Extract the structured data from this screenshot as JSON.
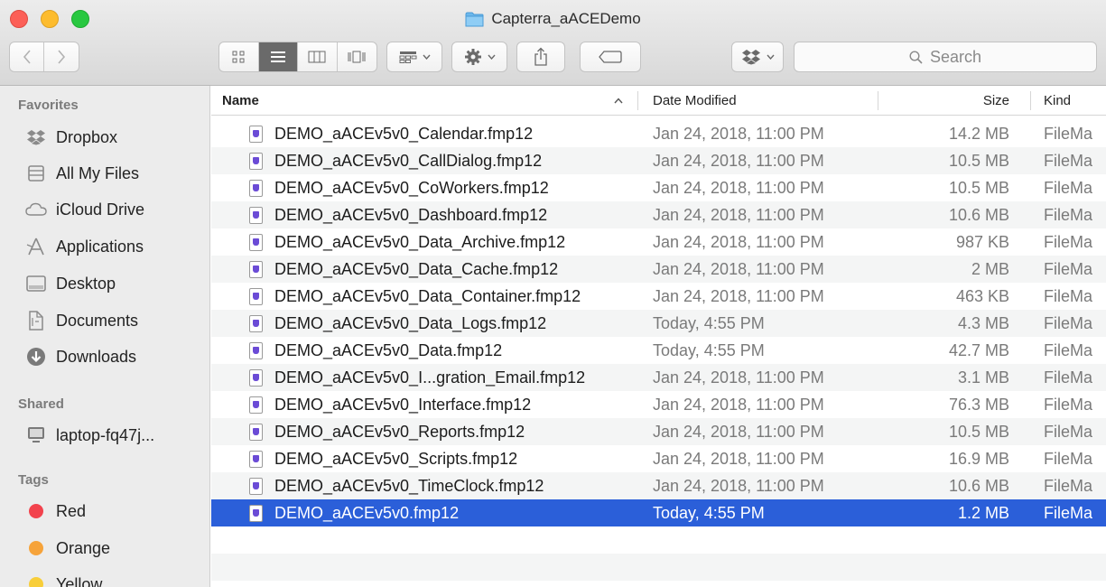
{
  "window": {
    "title": "Capterra_aACEDemo"
  },
  "toolbar": {
    "search_placeholder": "Search",
    "icons": [
      "back-icon",
      "forward-icon",
      "icon-view-icon",
      "list-view-icon",
      "column-view-icon",
      "cover-flow-icon",
      "group-icon",
      "action-gear-icon",
      "share-icon",
      "tag-icon",
      "dropbox-icon",
      "search-icon"
    ]
  },
  "sidebar": {
    "favorites_heading": "Favorites",
    "favorites": [
      {
        "label": "Dropbox",
        "icon": "dropbox-icon"
      },
      {
        "label": "All My Files",
        "icon": "all-files-icon"
      },
      {
        "label": "iCloud Drive",
        "icon": "cloud-icon"
      },
      {
        "label": "Applications",
        "icon": "applications-icon"
      },
      {
        "label": "Desktop",
        "icon": "desktop-icon"
      },
      {
        "label": "Documents",
        "icon": "documents-icon"
      },
      {
        "label": "Downloads",
        "icon": "downloads-icon"
      }
    ],
    "shared_heading": "Shared",
    "shared": [
      {
        "label": "laptop-fq47j...",
        "icon": "computer-icon"
      }
    ],
    "tags_heading": "Tags",
    "tags": [
      {
        "label": "Red",
        "color": "#f2434d"
      },
      {
        "label": "Orange",
        "color": "#f6a33a"
      },
      {
        "label": "Yellow",
        "color": "#f8ce3a"
      }
    ]
  },
  "columns": {
    "name": "Name",
    "sort_indicator": "^",
    "date": "Date Modified",
    "size": "Size",
    "kind": "Kind"
  },
  "files": [
    {
      "name": "DEMO_aACEv5v0_Calendar.fmp12",
      "date": "Jan 24, 2018, 11:00 PM",
      "size": "14.2 MB",
      "kind": "FileMa"
    },
    {
      "name": "DEMO_aACEv5v0_CallDialog.fmp12",
      "date": "Jan 24, 2018, 11:00 PM",
      "size": "10.5 MB",
      "kind": "FileMa"
    },
    {
      "name": "DEMO_aACEv5v0_CoWorkers.fmp12",
      "date": "Jan 24, 2018, 11:00 PM",
      "size": "10.5 MB",
      "kind": "FileMa"
    },
    {
      "name": "DEMO_aACEv5v0_Dashboard.fmp12",
      "date": "Jan 24, 2018, 11:00 PM",
      "size": "10.6 MB",
      "kind": "FileMa"
    },
    {
      "name": "DEMO_aACEv5v0_Data_Archive.fmp12",
      "date": "Jan 24, 2018, 11:00 PM",
      "size": "987 KB",
      "kind": "FileMa"
    },
    {
      "name": "DEMO_aACEv5v0_Data_Cache.fmp12",
      "date": "Jan 24, 2018, 11:00 PM",
      "size": "2 MB",
      "kind": "FileMa"
    },
    {
      "name": "DEMO_aACEv5v0_Data_Container.fmp12",
      "date": "Jan 24, 2018, 11:00 PM",
      "size": "463 KB",
      "kind": "FileMa"
    },
    {
      "name": "DEMO_aACEv5v0_Data_Logs.fmp12",
      "date": "Today, 4:55 PM",
      "size": "4.3 MB",
      "kind": "FileMa"
    },
    {
      "name": "DEMO_aACEv5v0_Data.fmp12",
      "date": "Today, 4:55 PM",
      "size": "42.7 MB",
      "kind": "FileMa"
    },
    {
      "name": "DEMO_aACEv5v0_I...gration_Email.fmp12",
      "date": "Jan 24, 2018, 11:00 PM",
      "size": "3.1 MB",
      "kind": "FileMa"
    },
    {
      "name": "DEMO_aACEv5v0_Interface.fmp12",
      "date": "Jan 24, 2018, 11:00 PM",
      "size": "76.3 MB",
      "kind": "FileMa"
    },
    {
      "name": "DEMO_aACEv5v0_Reports.fmp12",
      "date": "Jan 24, 2018, 11:00 PM",
      "size": "10.5 MB",
      "kind": "FileMa"
    },
    {
      "name": "DEMO_aACEv5v0_Scripts.fmp12",
      "date": "Jan 24, 2018, 11:00 PM",
      "size": "16.9 MB",
      "kind": "FileMa"
    },
    {
      "name": "DEMO_aACEv5v0_TimeClock.fmp12",
      "date": "Jan 24, 2018, 11:00 PM",
      "size": "10.6 MB",
      "kind": "FileMa"
    },
    {
      "name": "DEMO_aACEv5v0.fmp12",
      "date": "Today, 4:55 PM",
      "size": "1.2 MB",
      "kind": "FileMa",
      "selected": true
    }
  ],
  "colors": {
    "selection": "#2b5fd9",
    "filemaker_icon": "#6b4bd6"
  }
}
